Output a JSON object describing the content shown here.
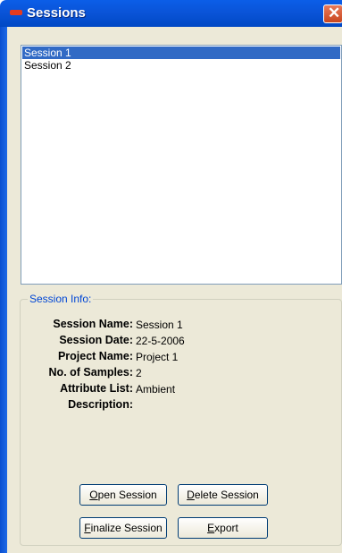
{
  "window": {
    "title": "Sessions",
    "close_symbol": "✕"
  },
  "sessions_list": [
    {
      "label": "Session 1",
      "selected": true
    },
    {
      "label": "Session 2",
      "selected": false
    }
  ],
  "session_info": {
    "legend": "Session Info:",
    "fields": [
      {
        "label": "Session Name:",
        "value": "Session 1"
      },
      {
        "label": "Session Date:",
        "value": "22-5-2006"
      },
      {
        "label": "Project Name:",
        "value": "Project 1"
      },
      {
        "label": "No. of Samples:",
        "value": "2"
      },
      {
        "label": "Attribute List:",
        "value": "Ambient"
      },
      {
        "label": "Description:",
        "value": ""
      }
    ]
  },
  "buttons": {
    "open": {
      "accel": "O",
      "rest": "pen Session"
    },
    "delete": {
      "accel": "D",
      "rest": "elete Session"
    },
    "finalize": {
      "accel": "F",
      "rest": "inalize Session"
    },
    "export": {
      "accel": "E",
      "rest": "xport"
    }
  },
  "colors": {
    "title_bar": "#0a54d8",
    "selection": "#316ac5",
    "dialog_bg": "#ece9d8",
    "legend_text": "#0046d5"
  }
}
